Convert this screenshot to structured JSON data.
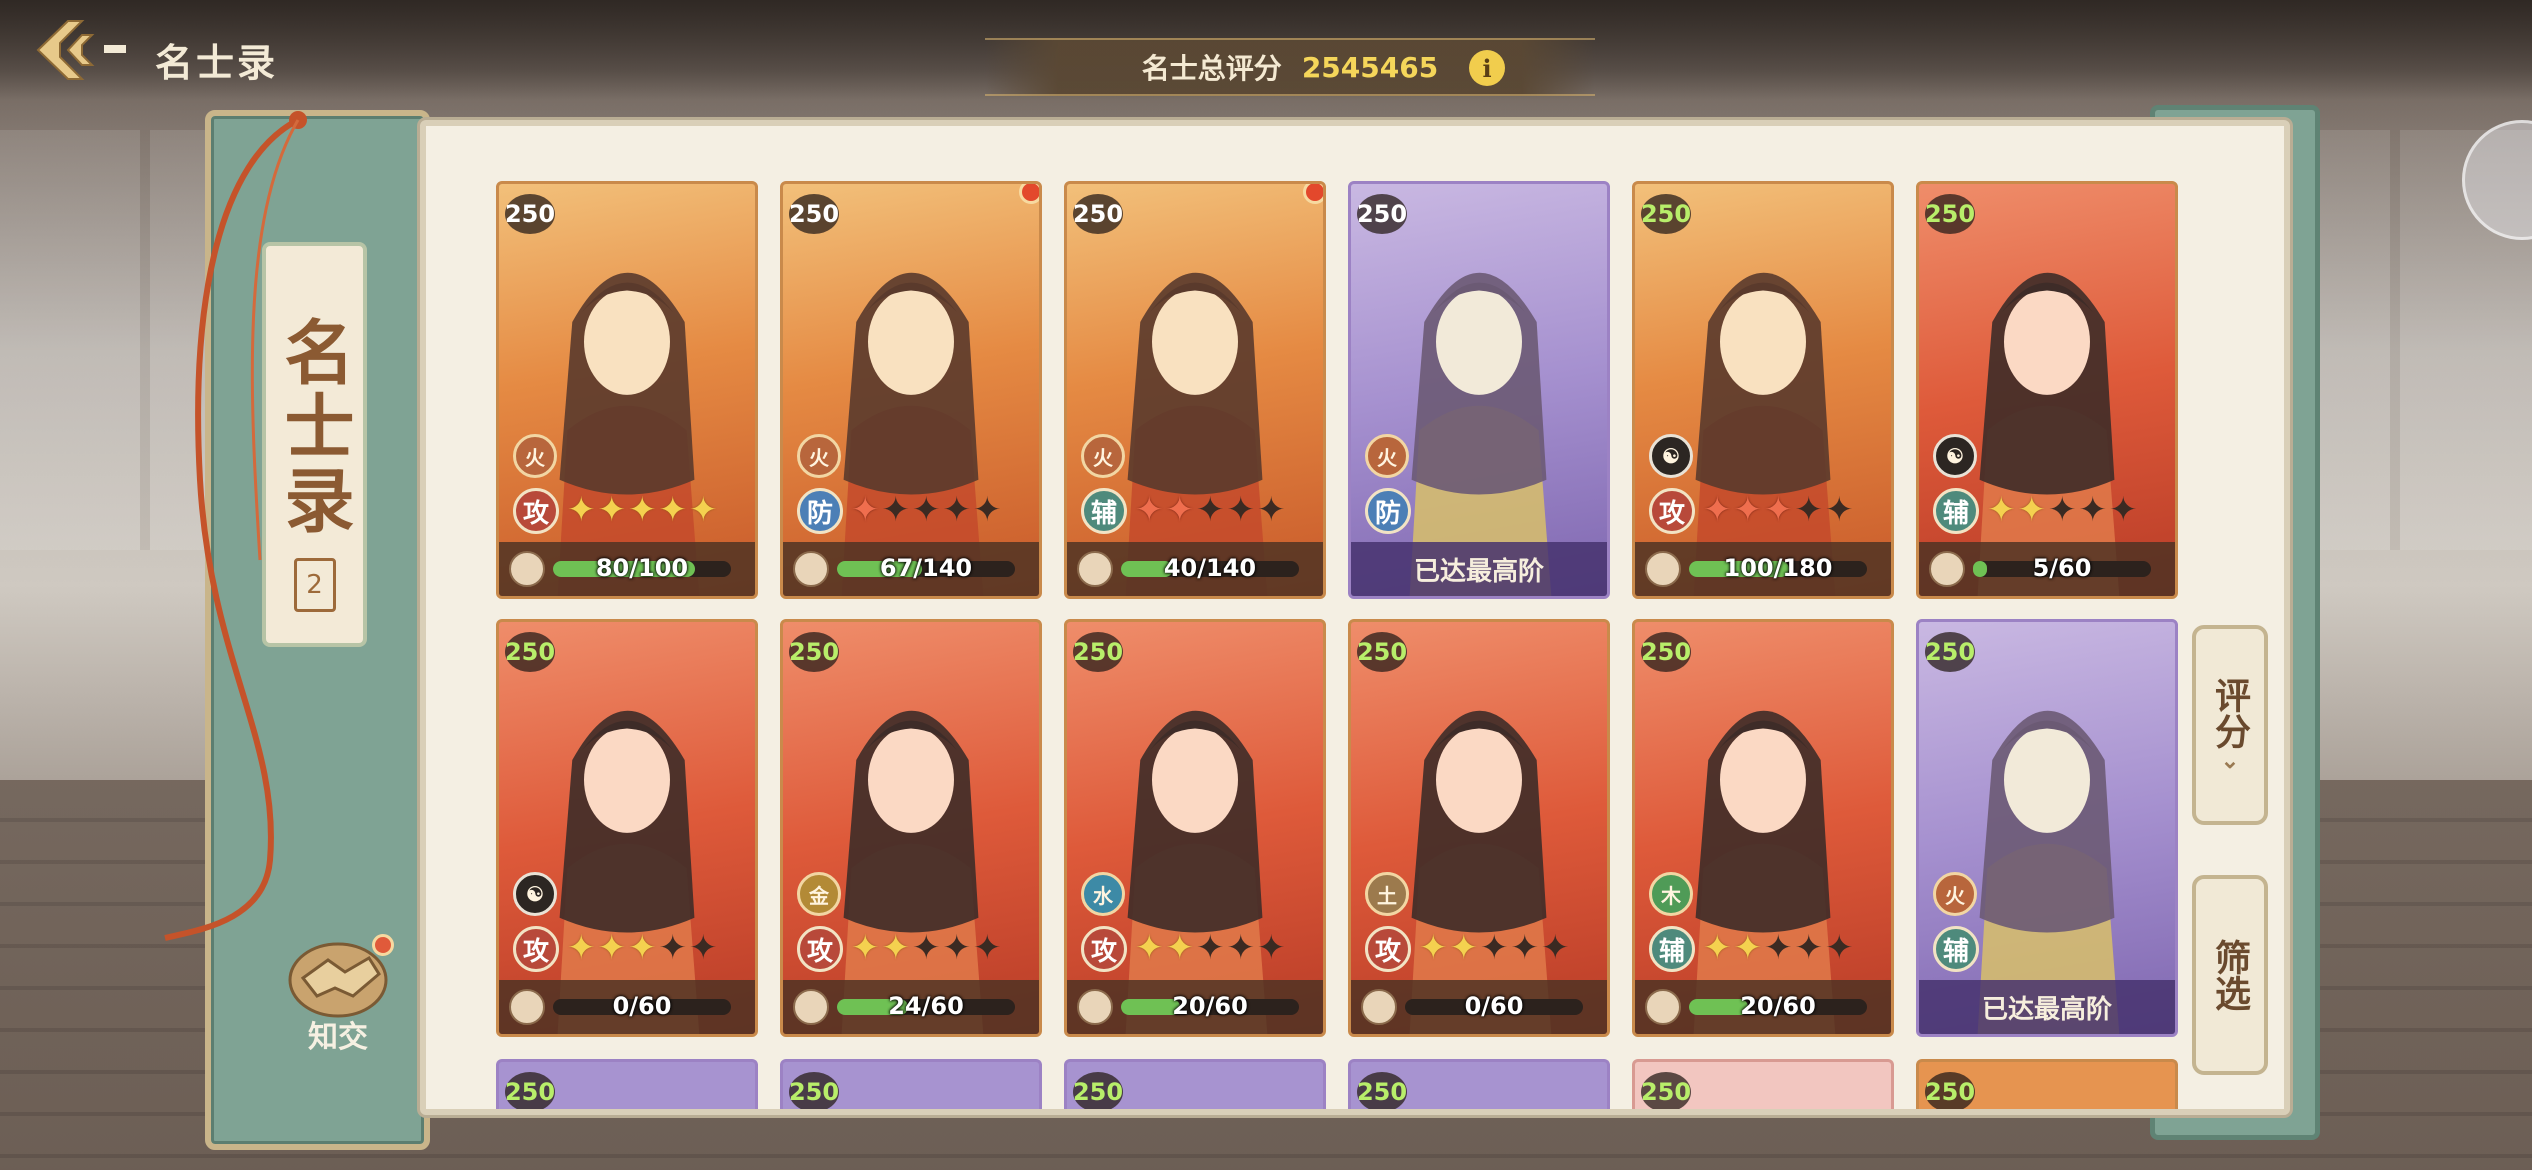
{
  "header": {
    "title": "名士录",
    "score_label": "名士总评分",
    "score_value": "2545465",
    "info_symbol": "i"
  },
  "book": {
    "label": "名士录",
    "seal": "2"
  },
  "friend_button": {
    "label": "知交"
  },
  "side_buttons": {
    "sort": {
      "label": "评分",
      "chevron": "⌄"
    },
    "filter": {
      "label": "筛选"
    }
  },
  "cards": [
    {
      "level": "250",
      "element": "火",
      "role": "攻",
      "stars": [
        "gold",
        "gold",
        "gold",
        "gold",
        "gold"
      ],
      "progress": "80/100",
      "progress_value": 0.8,
      "theme": "orange",
      "level_color": "white",
      "red_dot": false
    },
    {
      "level": "250",
      "element": "火",
      "role": "防",
      "stars": [
        "red",
        "dark",
        "dark",
        "dark",
        "dark"
      ],
      "progress": "67/140",
      "progress_value": 0.48,
      "theme": "orange",
      "level_color": "white",
      "red_dot": true
    },
    {
      "level": "250",
      "element": "火",
      "role": "辅",
      "stars": [
        "red",
        "red",
        "dark",
        "dark",
        "dark"
      ],
      "progress": "40/140",
      "progress_value": 0.29,
      "theme": "orange",
      "level_color": "white",
      "red_dot": true
    },
    {
      "level": "250",
      "element": "火",
      "role": "防",
      "stars": [],
      "maxed": "已达最高阶",
      "theme": "purple",
      "level_color": "white",
      "red_dot": false
    },
    {
      "level": "250",
      "element": "☯",
      "role": "攻",
      "stars": [
        "red",
        "red",
        "red",
        "dark",
        "dark"
      ],
      "progress": "100/180",
      "progress_value": 0.56,
      "theme": "orange",
      "level_color": "green",
      "red_dot": false
    },
    {
      "level": "250",
      "element": "☯",
      "role": "辅",
      "stars": [
        "gold",
        "gold",
        "dark",
        "dark",
        "dark"
      ],
      "progress": "5/60",
      "progress_value": 0.08,
      "theme": "red",
      "level_color": "green",
      "red_dot": false
    },
    {
      "level": "250",
      "element": "☯",
      "role": "攻",
      "stars": [
        "gold",
        "gold",
        "gold",
        "dark",
        "dark"
      ],
      "progress": "0/60",
      "progress_value": 0.0,
      "theme": "red",
      "level_color": "green",
      "red_dot": false
    },
    {
      "level": "250",
      "element": "金",
      "role": "攻",
      "stars": [
        "gold",
        "gold",
        "dark",
        "dark",
        "dark"
      ],
      "progress": "24/60",
      "progress_value": 0.4,
      "theme": "red",
      "level_color": "green",
      "red_dot": false
    },
    {
      "level": "250",
      "element": "水",
      "role": "攻",
      "stars": [
        "gold",
        "gold",
        "dark",
        "dark",
        "dark"
      ],
      "progress": "20/60",
      "progress_value": 0.33,
      "theme": "red",
      "level_color": "green",
      "red_dot": false
    },
    {
      "level": "250",
      "element": "土",
      "role": "攻",
      "stars": [
        "gold",
        "gold",
        "dark",
        "dark",
        "dark"
      ],
      "progress": "0/60",
      "progress_value": 0.0,
      "theme": "red",
      "level_color": "green",
      "red_dot": false
    },
    {
      "level": "250",
      "element": "木",
      "role": "辅",
      "stars": [
        "gold",
        "gold",
        "dark",
        "dark",
        "dark"
      ],
      "progress": "20/60",
      "progress_value": 0.33,
      "theme": "red",
      "level_color": "green",
      "red_dot": false
    },
    {
      "level": "250",
      "element": "火",
      "role": "辅",
      "stars": [],
      "maxed": "已达最高阶",
      "theme": "purple",
      "level_color": "green",
      "red_dot": false
    }
  ],
  "partial_cards": [
    {
      "level": "250",
      "theme": "purple"
    },
    {
      "level": "250",
      "theme": "purple"
    },
    {
      "level": "250",
      "theme": "purple"
    },
    {
      "level": "250",
      "theme": "purple"
    },
    {
      "level": "250",
      "theme": "pink"
    },
    {
      "level": "250",
      "theme": "orange"
    }
  ],
  "colors": {
    "panel_green": "#7fa394",
    "paper": "#f4efe3",
    "score_gold": "#f5d65a",
    "progress_green": "#6fc154",
    "notification_red": "#e3482c"
  }
}
